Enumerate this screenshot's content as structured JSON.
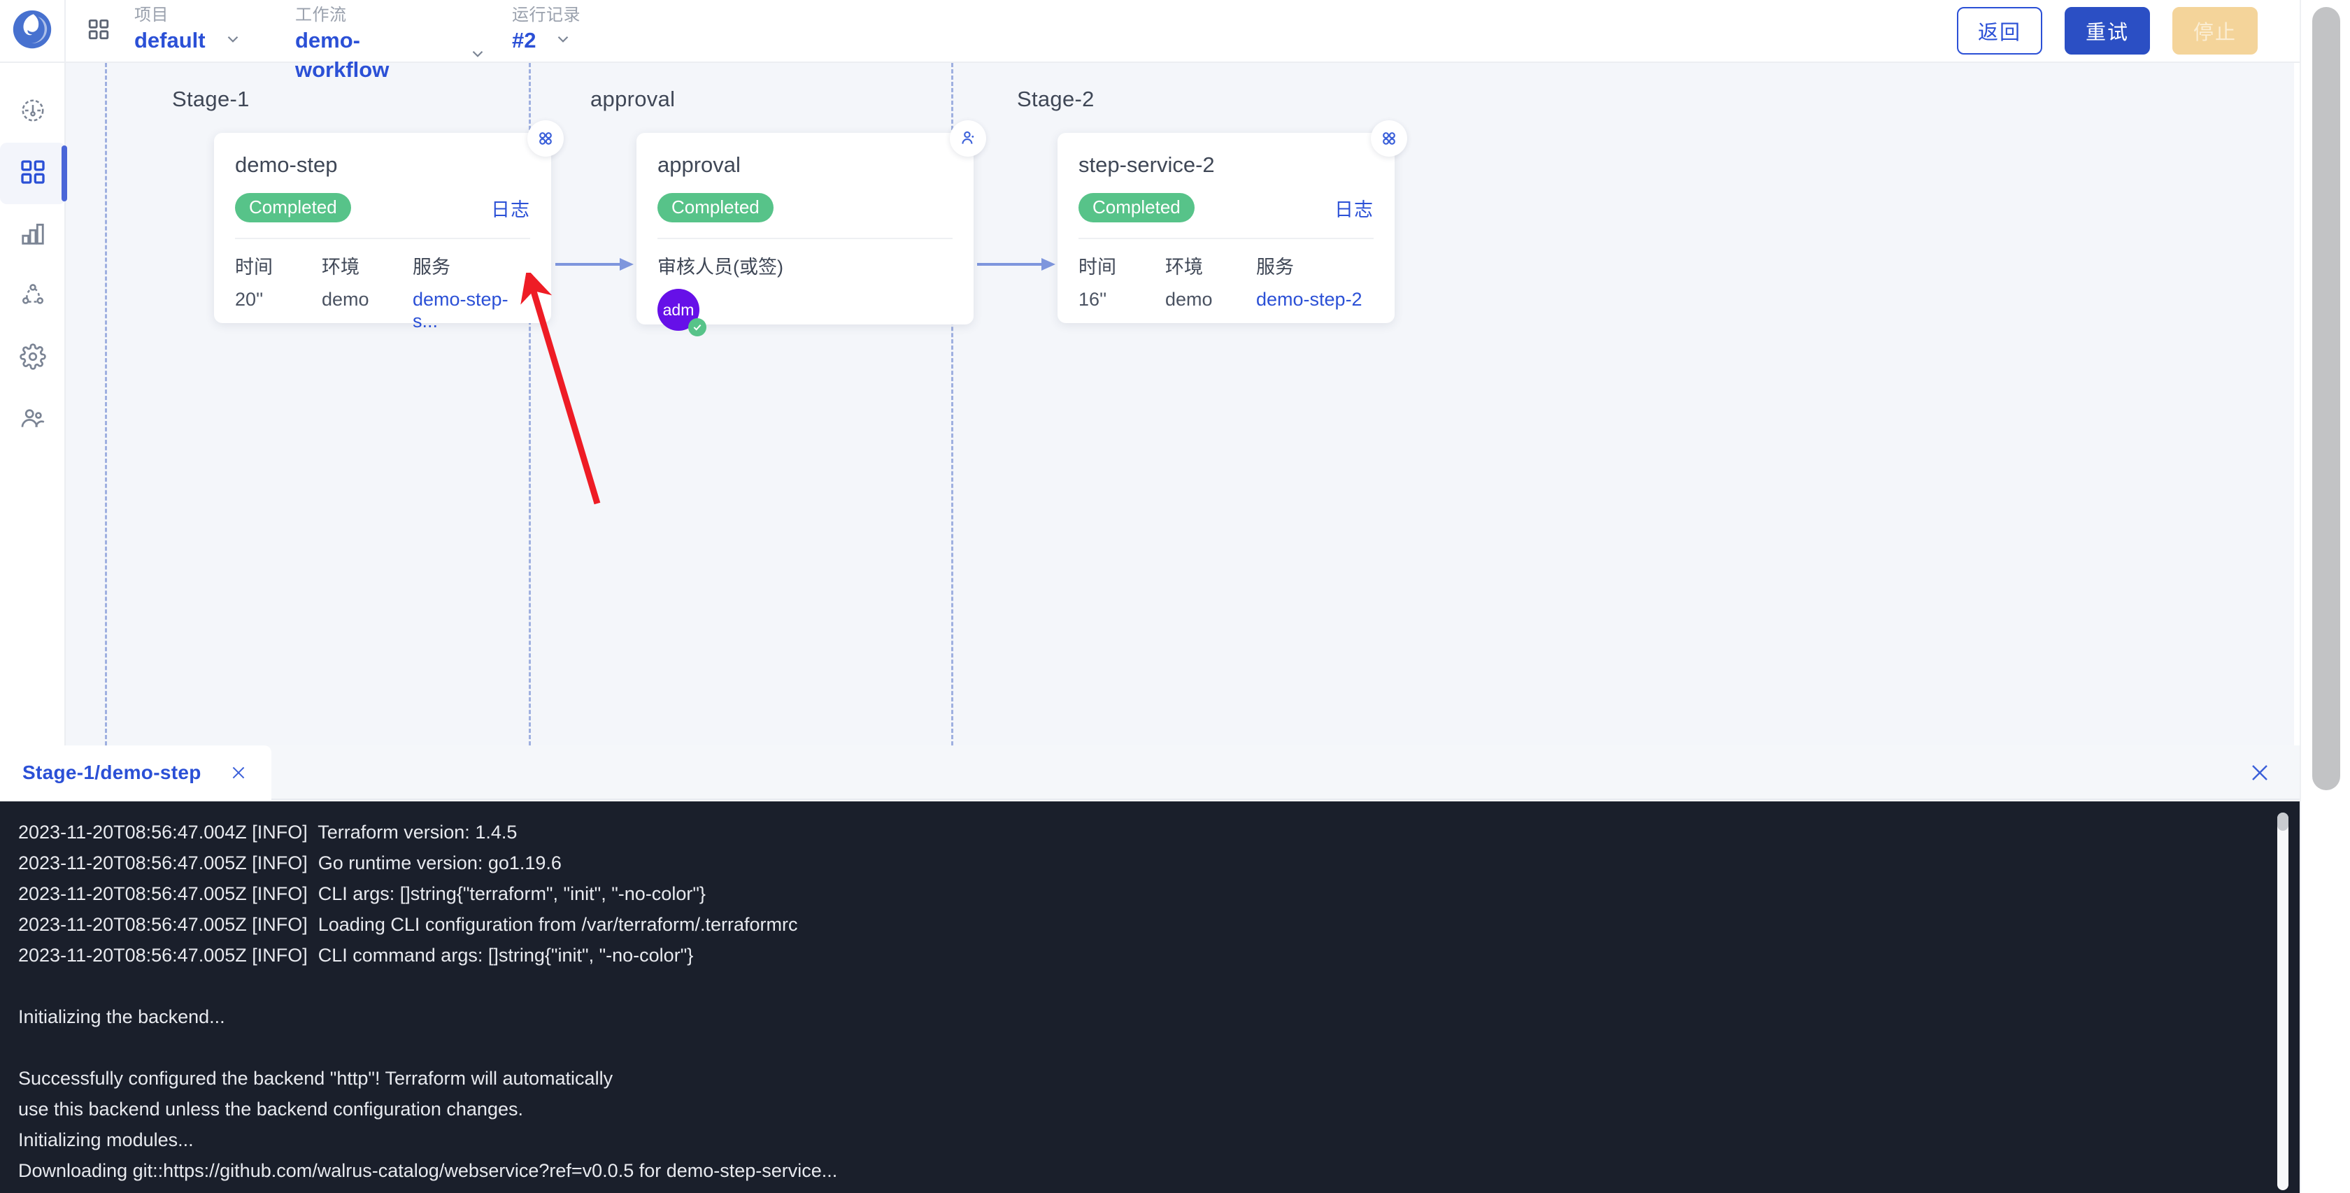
{
  "app": {
    "logo_icon": "seal-logo-icon",
    "apps_grid_icon": "apps-grid-icon"
  },
  "breadcrumb": {
    "items": [
      {
        "label": "项目",
        "value": "default",
        "icon": "chevron-down-icon"
      },
      {
        "label": "工作流",
        "value": "demo-workflow",
        "icon": "chevron-down-icon"
      },
      {
        "label": "运行记录",
        "value": "#2",
        "icon": "chevron-down-icon"
      }
    ]
  },
  "header_actions": {
    "back_label": "返回",
    "retry_label": "重试",
    "stop_label": "停止",
    "colors": {
      "primary": "#2b4fc4",
      "outline": "#2b50d6",
      "disabled_bg": "#f4d49a"
    }
  },
  "sidebar": {
    "items": [
      {
        "name": "dashboard",
        "icon": "dashboard-gauge-icon",
        "active": false
      },
      {
        "name": "applications",
        "icon": "apps-grid-icon",
        "active": true
      },
      {
        "name": "analytics",
        "icon": "bar-chart-icon",
        "active": false
      },
      {
        "name": "connectors",
        "icon": "network-nodes-icon",
        "active": false
      },
      {
        "name": "settings",
        "icon": "gear-icon",
        "active": false
      },
      {
        "name": "users",
        "icon": "users-icon",
        "active": false
      }
    ]
  },
  "pipeline": {
    "stages": [
      {
        "title": "Stage-1",
        "card": {
          "name": "demo-step",
          "status": "Completed",
          "log_link": "日志",
          "corner_icon": "service-node-icon",
          "columns": [
            "时间",
            "环境",
            "服务"
          ],
          "values": [
            "20''",
            "demo",
            "demo-step-s..."
          ],
          "service_is_link": true
        }
      },
      {
        "title": "approval",
        "card": {
          "name": "approval",
          "status": "Completed",
          "corner_icon": "approval-user-icon",
          "approver_label": "审核人员(或签)",
          "approvers": [
            {
              "initials": "adm",
              "color": "#6610e8",
              "approved": true
            }
          ]
        }
      },
      {
        "title": "Stage-2",
        "card": {
          "name": "step-service-2",
          "status": "Completed",
          "log_link": "日志",
          "corner_icon": "service-node-icon",
          "columns": [
            "时间",
            "环境",
            "服务"
          ],
          "values": [
            "16''",
            "demo",
            "demo-step-2"
          ],
          "service_is_link": true
        }
      }
    ],
    "status_color": "#57c389"
  },
  "annotation": {
    "type": "arrow",
    "color": "#ee1c25",
    "points_to": "日志 link on demo-step card"
  },
  "log_panel": {
    "tab_label": "Stage-1/demo-step",
    "tab_close_icon": "close-icon",
    "panel_close_icon": "close-icon",
    "lines": [
      "2023-11-20T08:56:47.004Z [INFO]  Terraform version: 1.4.5",
      "2023-11-20T08:56:47.005Z [INFO]  Go runtime version: go1.19.6",
      "2023-11-20T08:56:47.005Z [INFO]  CLI args: []string{\"terraform\", \"init\", \"-no-color\"}",
      "2023-11-20T08:56:47.005Z [INFO]  Loading CLI configuration from /var/terraform/.terraformrc",
      "2023-11-20T08:56:47.005Z [INFO]  CLI command args: []string{\"init\", \"-no-color\"}",
      "",
      "Initializing the backend...",
      "",
      "Successfully configured the backend \"http\"! Terraform will automatically",
      "use this backend unless the backend configuration changes.",
      "Initializing modules...",
      "Downloading git::https://github.com/walrus-catalog/webservice?ref=v0.0.5 for demo-step-service..."
    ],
    "terminal_bg": "#1a1f2b"
  }
}
